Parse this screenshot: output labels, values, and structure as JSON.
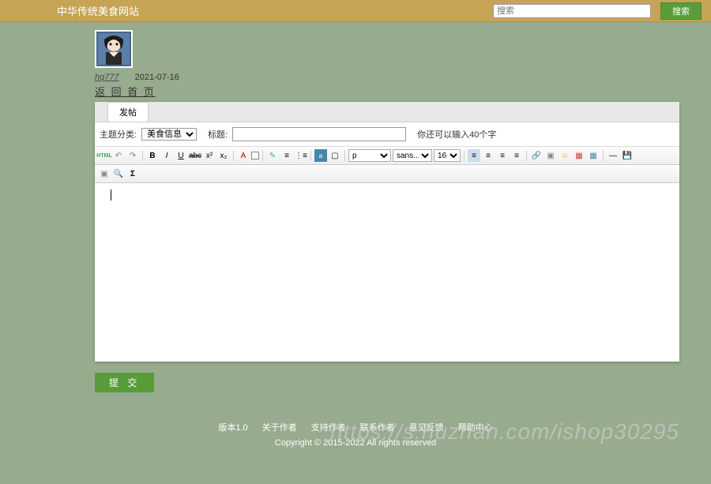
{
  "header": {
    "site_title": "中华传统美食网站",
    "search_placeholder": "搜索",
    "search_button": "搜索"
  },
  "user": {
    "username": "hq777",
    "date": "2021-07-16",
    "back_link": "返 回 首 页"
  },
  "form": {
    "tab_label": "发帖",
    "category_label": "主题分类:",
    "category_value": "美食信息",
    "title_label": "标题:",
    "title_value": "",
    "hint": "你还可以输入40个字",
    "format_select": "p",
    "font_select": "sans...",
    "size_select": "16",
    "submit_label": "提 交"
  },
  "footer": {
    "links": [
      "版本1.0",
      "关于作者",
      "支持作者",
      "联系作者",
      "意见反馈",
      "帮助中心"
    ],
    "copyright": "Copyright © 2015-2022 All rights reserved"
  },
  "watermark": "https://s.huzhan.com/ishop30295"
}
